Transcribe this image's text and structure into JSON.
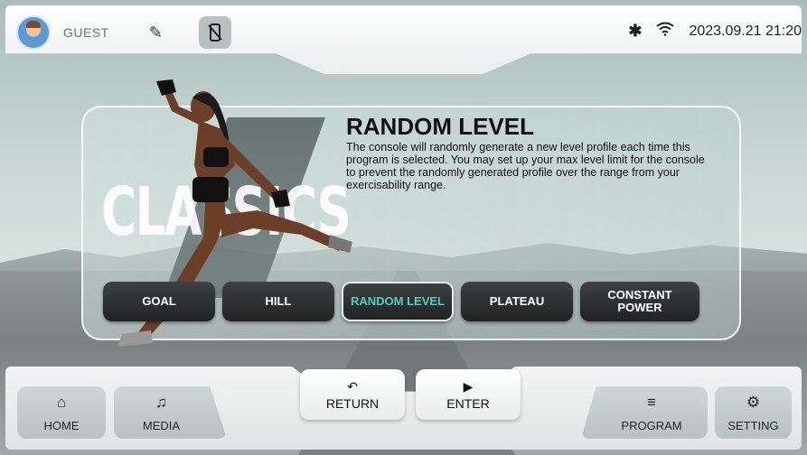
{
  "topbar": {
    "user_label": "GUEST",
    "datetime": "2023.09.21 21:20",
    "icons": {
      "avatar": "avatar-icon",
      "edit": "pencil-icon",
      "phone": "phone-disabled-icon",
      "bluetooth": "bluetooth-off-icon",
      "wifi": "wifi-icon"
    }
  },
  "brand": {
    "text": "CLASSICS"
  },
  "program": {
    "title": "RANDOM LEVEL",
    "description": "The console will randomly generate a new level profile each time this program is selected. You may set up your max level limit for the console to prevent the randomly generated profile over the range from your exercisability range."
  },
  "program_buttons": [
    {
      "label": "GOAL"
    },
    {
      "label": "HILL"
    },
    {
      "label": "RANDOM LEVEL"
    },
    {
      "label": "PLATEAU"
    },
    {
      "label": "CONSTANT\nPOWER"
    }
  ],
  "actions": {
    "return_label": "RETURN",
    "enter_label": "ENTER"
  },
  "nav": {
    "home_label": "HOME",
    "media_label": "MEDIA",
    "program_label": "PROGRAM",
    "setting_label": "SETTING"
  },
  "colors": {
    "active_text": "#4dd2b8",
    "button_dark": "#1f2423"
  }
}
